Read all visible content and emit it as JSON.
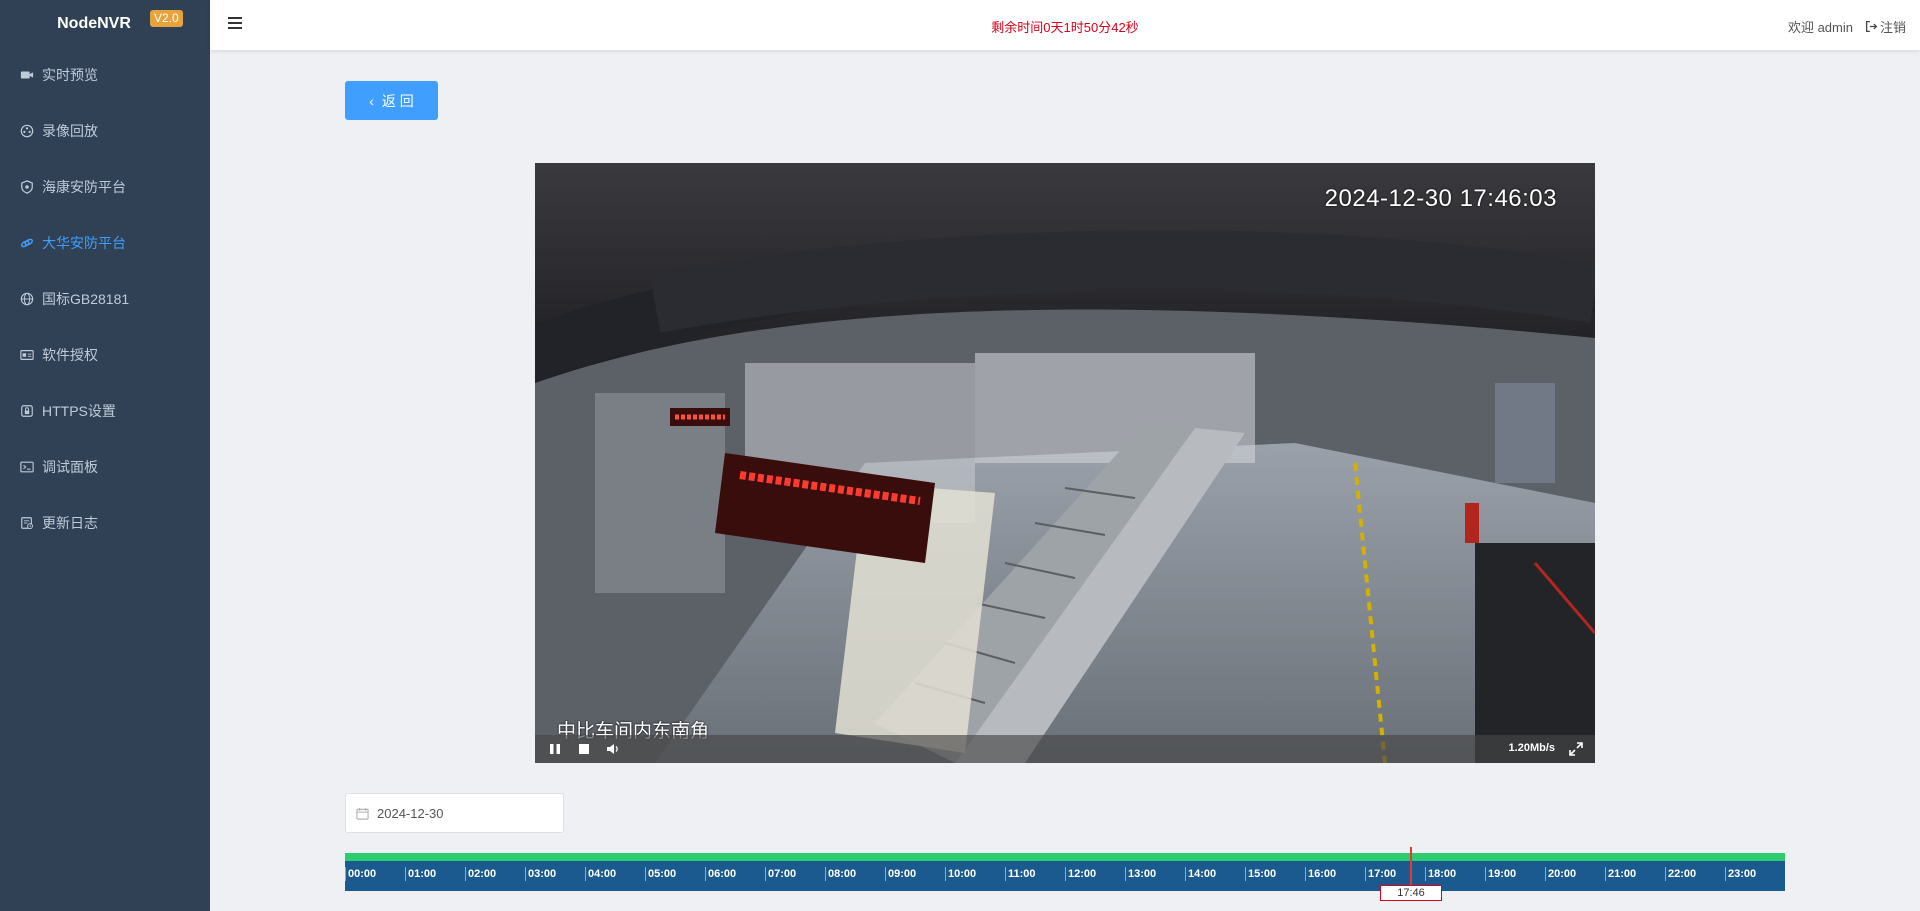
{
  "brand": {
    "name": "NodeNVR",
    "version": "V2.0"
  },
  "sidebar": {
    "items": [
      {
        "label": "实时预览",
        "icon": "camera-icon",
        "active": false
      },
      {
        "label": "录像回放",
        "icon": "playback-icon",
        "active": false
      },
      {
        "label": "海康安防平台",
        "icon": "shield-icon",
        "active": false
      },
      {
        "label": "大华安防平台",
        "icon": "link-icon",
        "active": true
      },
      {
        "label": "国标GB28181",
        "icon": "globe-icon",
        "active": false
      },
      {
        "label": "软件授权",
        "icon": "license-icon",
        "active": false
      },
      {
        "label": "HTTPS设置",
        "icon": "lock-icon",
        "active": false
      },
      {
        "label": "调试面板",
        "icon": "terminal-icon",
        "active": false
      },
      {
        "label": "更新日志",
        "icon": "log-icon",
        "active": false
      }
    ]
  },
  "header": {
    "remaining_time": "剩余时间0天1时50分42秒",
    "welcome": "欢迎 admin",
    "logout": "注销"
  },
  "back_button": {
    "label": "返 回"
  },
  "video": {
    "osd_timestamp": "2024-12-30 17:46:03",
    "osd_channel_name": "中比车间内东南角",
    "bitrate": "1.20Mb/s",
    "playback_state": "playing"
  },
  "date_picker": {
    "value": "2024-12-30"
  },
  "timeline": {
    "hours": [
      "00:00",
      "01:00",
      "02:00",
      "03:00",
      "04:00",
      "05:00",
      "06:00",
      "07:00",
      "08:00",
      "09:00",
      "10:00",
      "11:00",
      "12:00",
      "13:00",
      "14:00",
      "15:00",
      "16:00",
      "17:00",
      "18:00",
      "19:00",
      "20:00",
      "21:00",
      "22:00",
      "23:00"
    ],
    "current_time": "17:46",
    "recorded_fraction": 1.0
  },
  "colors": {
    "sidebar_bg": "#304156",
    "active": "#409eff",
    "alert": "#d9001b",
    "timeline_bg": "#1a5a8f",
    "timeline_recorded": "#2ecc71",
    "timeline_cursor": "#e53935"
  }
}
